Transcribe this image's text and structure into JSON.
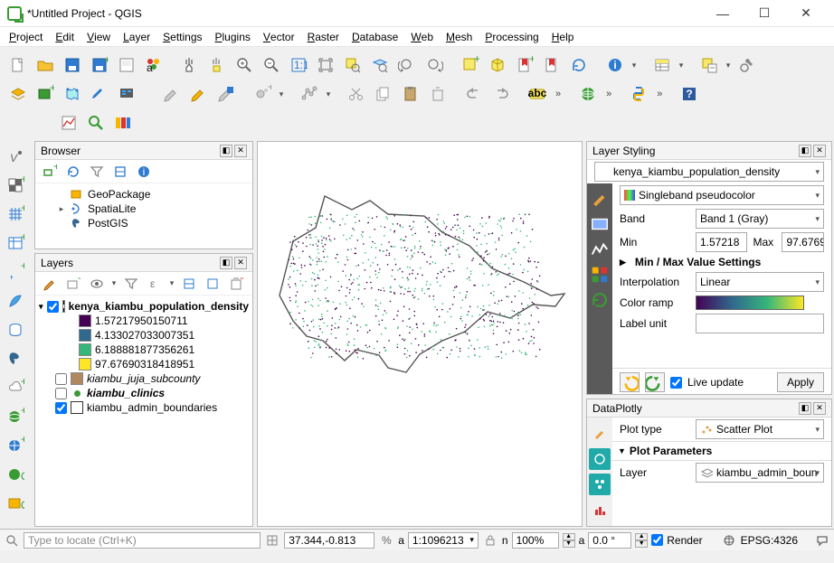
{
  "window": {
    "title": "*Untitled Project - QGIS"
  },
  "menu": [
    "Project",
    "Edit",
    "View",
    "Layer",
    "Settings",
    "Plugins",
    "Vector",
    "Raster",
    "Database",
    "Web",
    "Mesh",
    "Processing",
    "Help"
  ],
  "toolbar_row1": [
    "new-project",
    "open-project",
    "save-project",
    "save-project-as",
    "print-layout",
    "style-manager",
    "|",
    "pan",
    "pan-to-selection",
    "zoom-in",
    "zoom-out",
    "zoom-native",
    "zoom-full",
    "zoom-selection",
    "zoom-layer",
    "zoom-last",
    "zoom-next",
    "|",
    "new-map-view",
    "new-3d-map",
    "new-bookmark",
    "bookmarks",
    "refresh",
    "|",
    "identify",
    "dd",
    "|",
    "open-attribute-table",
    "dd",
    "|",
    "field-calculator",
    "dd",
    "toolbox"
  ],
  "toolbar_row2": [
    "open-data-source",
    "new-geopackage",
    "new-shapefile",
    "new-spatialite",
    "new-virtual",
    "|",
    "|",
    "current-edits",
    "toggle-editing",
    "save-edits",
    "|",
    "add-feature",
    "dd",
    "|",
    "vertex-tool",
    "dd",
    "|",
    "cut-features",
    "copy-features",
    "paste-features",
    "delete-selected",
    "|",
    "undo",
    "redo",
    "|",
    "abc",
    "more",
    "|",
    "web",
    "more",
    "|",
    "python",
    "more",
    "|",
    "help"
  ],
  "toolbar_row3": [
    "stats-icon",
    "fluorescent-icon",
    "multi-color-icon"
  ],
  "left_strip": [
    "vector-v",
    "add-raster",
    "add-mesh",
    "add-delimited",
    "comma",
    "feather",
    "sql",
    "postgres",
    "cloud-plus",
    "globe-plus",
    "wms",
    "globe-q",
    "geopackage-q"
  ],
  "browser": {
    "title": "Browser",
    "items": [
      {
        "icon": "geopackage-icon",
        "label": "GeoPackage"
      },
      {
        "icon": "spatialite-icon",
        "label": "SpatiaLite",
        "expandable": true
      },
      {
        "icon": "postgis-icon",
        "label": "PostGIS"
      }
    ]
  },
  "layers": {
    "title": "Layers",
    "tree": {
      "raster": {
        "name": "kenya_kiambu_population_density",
        "checked": true,
        "classes": [
          {
            "color": "#440154",
            "label": "1.57217950150711"
          },
          {
            "color": "#31688e",
            "label": "4.133027033007351"
          },
          {
            "color": "#35b779",
            "label": "6.188881877356261"
          },
          {
            "color": "#fde725",
            "label": "97.67690318418951"
          }
        ]
      },
      "others": [
        {
          "name": "kiambu_juja_subcounty",
          "checked": false,
          "color": "#b08860",
          "italic": true
        },
        {
          "name": "kiambu_clinics",
          "checked": false,
          "color": "#3a9b35",
          "point": true,
          "italic": true,
          "bold": true
        },
        {
          "name": "kiambu_admin_boundaries",
          "checked": true,
          "outline": true
        }
      ]
    }
  },
  "layer_styling": {
    "title": "Layer Styling",
    "target_layer": "kenya_kiambu_population_density",
    "renderer": "Singleband pseudocolor",
    "band_label": "Band",
    "band": "Band 1 (Gray)",
    "min_label": "Min",
    "min": "1.57218",
    "max_label": "Max",
    "max": "97.6769",
    "minmax_header": "Min / Max Value Settings",
    "interp_label": "Interpolation",
    "interp": "Linear",
    "ramp_label": "Color ramp",
    "labelunit_label": "Label unit",
    "live_update": "Live update",
    "apply": "Apply"
  },
  "dataplotly": {
    "title": "DataPlotly",
    "plot_type_label": "Plot type",
    "plot_type": "Scatter Plot",
    "params_header": "Plot Parameters",
    "layer_label": "Layer",
    "layer": "kiambu_admin_boun"
  },
  "status": {
    "locator_placeholder": "Type to locate (Ctrl+K)",
    "coord": "37.344,-0.813",
    "scale_prefix": "a",
    "scale": "1:1096213",
    "magnifier_prefix": "n",
    "magnifier": "100%",
    "rotation_prefix": "a",
    "rotation": "0.0 °",
    "render": "Render",
    "crs": "EPSG:4326"
  }
}
